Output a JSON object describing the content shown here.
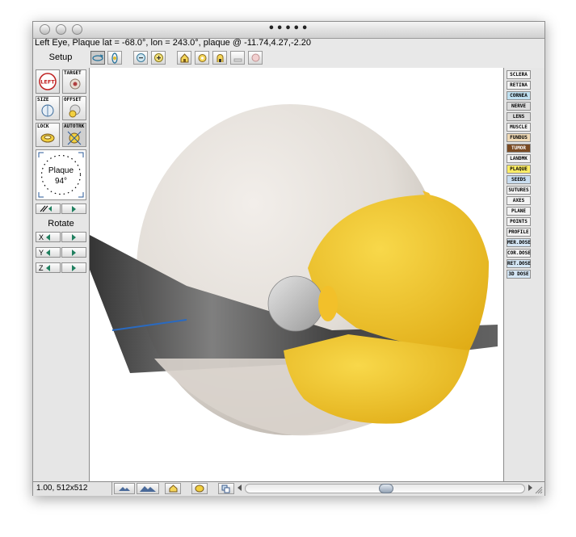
{
  "window": {
    "title": "•••••",
    "status_line": "Left Eye, Plaque lat = -68.0°, lon = 243.0°, plaque @ -11.74,4.27,-2.20"
  },
  "toolbar": {
    "setup_label": "Setup",
    "icons": [
      "rotate-view-icon",
      "tilt-view-icon",
      "zoom-out-icon",
      "zoom-in-icon",
      "home-icon",
      "view-top-icon",
      "view-side-icon",
      "render-flat-icon",
      "render-shade-icon"
    ]
  },
  "left_panel": {
    "buttons": [
      {
        "label": "",
        "icon": "left-eye-icon",
        "badge": "LEFT"
      },
      {
        "label": "TARGET",
        "icon": "target-icon"
      },
      {
        "label": "SIZE",
        "icon": "size-icon"
      },
      {
        "label": "OFFSET",
        "icon": "offset-icon"
      },
      {
        "label": "LOCK",
        "icon": "lock-icon"
      },
      {
        "label": "AUTOTRK",
        "icon": "autotrack-icon"
      }
    ],
    "dial": {
      "label": "Plaque",
      "value": "94°"
    },
    "rotate_label": "Rotate",
    "axes": [
      "X",
      "Y",
      "Z"
    ]
  },
  "right_panel": {
    "buttons": [
      {
        "label": "SCLERA",
        "color": "#f3f3f3"
      },
      {
        "label": "RETINA",
        "color": "#f3f3f3"
      },
      {
        "label": "CORNEA",
        "color": "#bfe0f0"
      },
      {
        "label": "NERVE",
        "color": "#dcdcdc"
      },
      {
        "label": "LENS",
        "color": "#dcdcdc"
      },
      {
        "label": "MUSCLE",
        "color": "#f3f3f3"
      },
      {
        "label": "FUNDUS",
        "color": "#efd9b5"
      },
      {
        "label": "TUMOR",
        "color": "#7a4a22"
      },
      {
        "label": "LANDMK",
        "color": "#f3f3f3"
      },
      {
        "label": "PLAQUE",
        "color": "#ffee66"
      },
      {
        "label": "SEEDS",
        "color": "#c9ddf0"
      },
      {
        "label": "SUTURES",
        "color": "#f3f3f3"
      },
      {
        "label": "AXES",
        "color": "#f3f3f3"
      },
      {
        "label": "PLANE",
        "color": "#f3f3f3"
      },
      {
        "label": "POINTS",
        "color": "#f3f3f3"
      },
      {
        "label": "PROFILE",
        "color": "#f3f3f3"
      },
      {
        "label": "MER.DOSE",
        "color": "#d4e6f5"
      },
      {
        "label": "COR.DOSE",
        "color": "#f3f3f3"
      },
      {
        "label": "RET.DOSE",
        "color": "#d4e6f5"
      },
      {
        "label": "3D DOSE",
        "color": "#d4e6f5"
      }
    ]
  },
  "bottom": {
    "zoom_text": "1.00, 512x512",
    "icons": [
      "mountain-small-icon",
      "mountain-large-icon",
      "house-icon",
      "yellow-disk-icon",
      "copy-icon"
    ]
  },
  "colors": {
    "sclera": "#e6e1dc",
    "plaque": "#f4c830",
    "nerve": "#c8c8c8",
    "tumor_text": "#ffffff"
  }
}
